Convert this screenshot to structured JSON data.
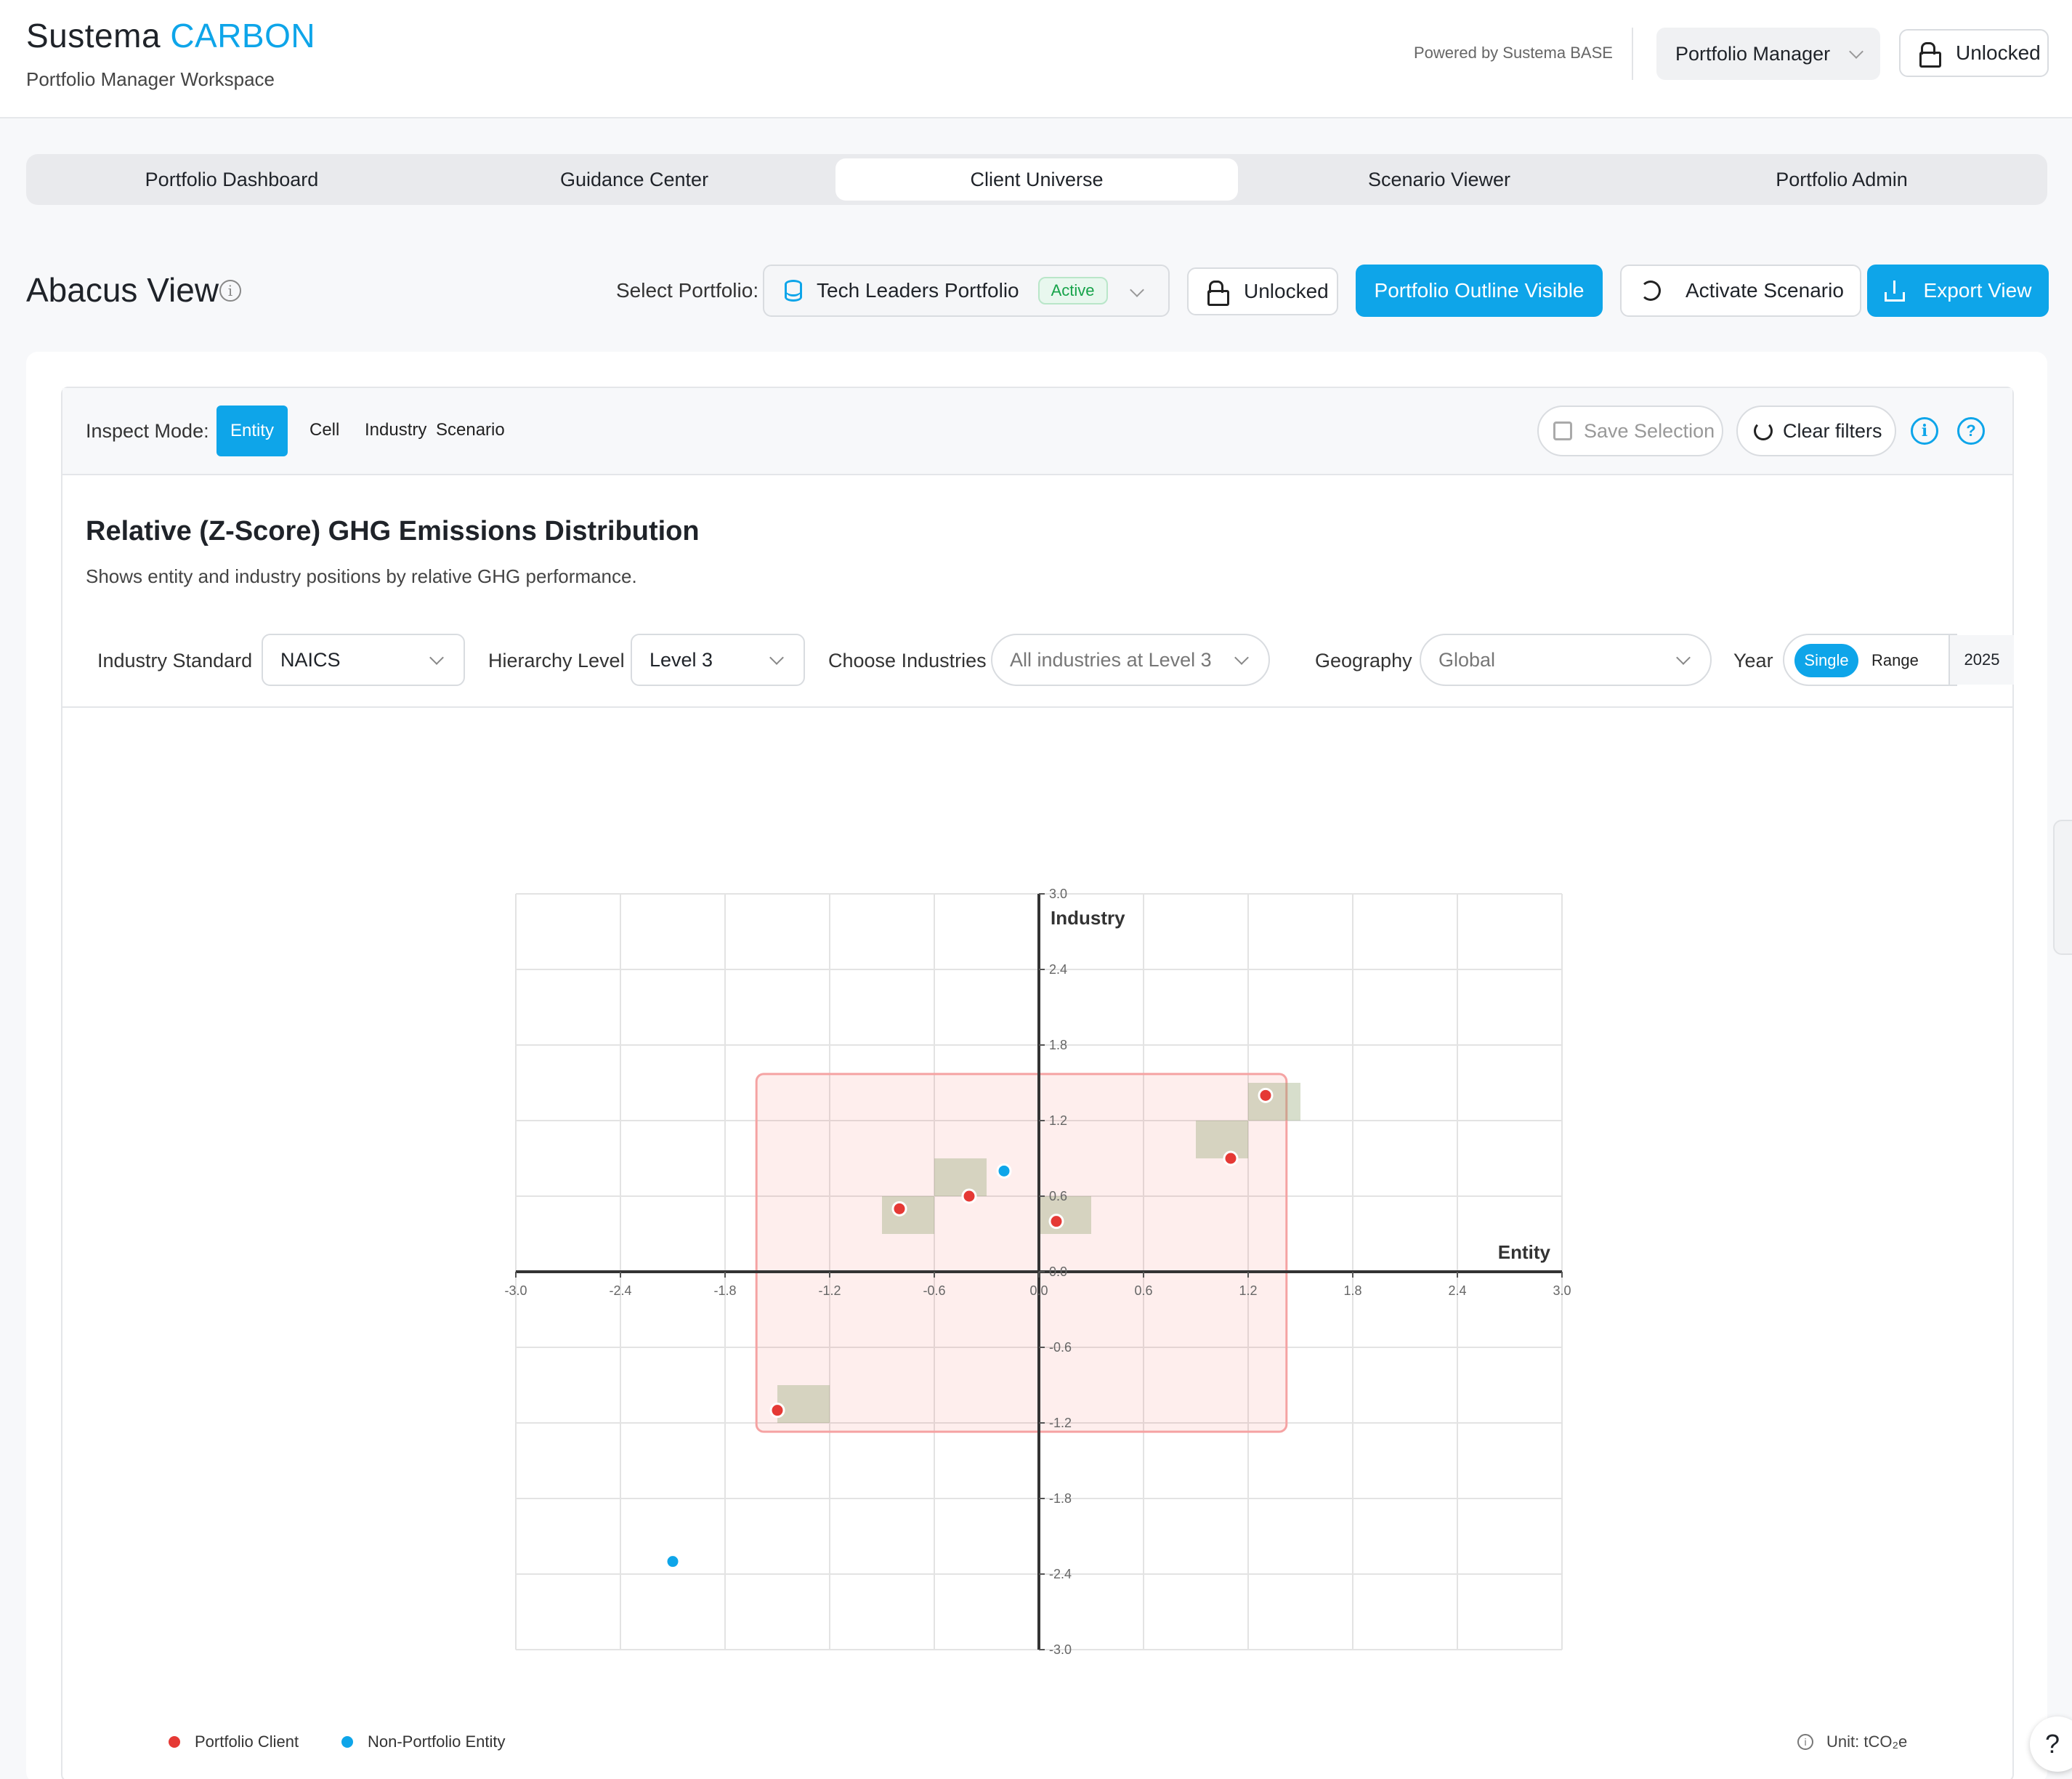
{
  "header": {
    "brand_main": "Sustema",
    "brand_accent": "CARBON",
    "workspace": "Portfolio Manager Workspace",
    "powered_by": "Powered by Sustema BASE",
    "role": "Portfolio Manager",
    "lock_status": "Unlocked"
  },
  "tabs": [
    "Portfolio Dashboard",
    "Guidance Center",
    "Client Universe",
    "Scenario Viewer",
    "Portfolio Admin"
  ],
  "active_tab": "Client Universe",
  "title_row": {
    "title": "Abacus View",
    "info_icon": "i",
    "select_portfolio_label": "Select Portfolio:",
    "portfolio": "Tech Leaders Portfolio",
    "portfolio_status": "Active",
    "lock_status": "Unlocked",
    "outline_button": "Portfolio Outline Visible",
    "activate_button": "Activate Scenario",
    "export_button": "Export View"
  },
  "inspect": {
    "label": "Inspect Mode:",
    "modes": [
      "Entity",
      "Cell",
      "Industry",
      "Scenario"
    ],
    "active_mode": "Entity",
    "save_selection": "Save Selection",
    "clear_filters": "Clear filters",
    "info_icon": "i",
    "help_icon": "?"
  },
  "chart_header": {
    "title": "Relative (Z-Score) GHG Emissions Distribution",
    "subtitle": "Shows entity and industry positions by relative GHG performance."
  },
  "filters": {
    "industry_standard_label": "Industry Standard",
    "industry_standard": "NAICS",
    "hierarchy_label": "Hierarchy Level",
    "hierarchy": "Level 3",
    "industries_label": "Choose Industries",
    "industries_placeholder": "All industries at Level 3",
    "geography_label": "Geography",
    "geography": "Global",
    "year_label": "Year",
    "year_single": "Single",
    "year_range": "Range",
    "year_value": "2025"
  },
  "chart_data": {
    "type": "scatter",
    "xlabel": "Entity",
    "ylabel": "Industry",
    "xlim": [
      -3.0,
      3.0
    ],
    "ylim": [
      -3.0,
      3.0
    ],
    "ticks": [
      "-3.0",
      "-2.4",
      "-1.8",
      "-1.2",
      "-0.6",
      "0.0",
      "0.6",
      "1.2",
      "1.8",
      "2.4",
      "3.0"
    ],
    "grid": true,
    "portfolio_outline": {
      "x": [
        -1.62,
        1.42
      ],
      "y": [
        -1.27,
        1.57
      ]
    },
    "cells": [
      {
        "x": [
          -1.5,
          -1.2
        ],
        "y": [
          -1.2,
          -0.9
        ]
      },
      {
        "x": [
          -0.9,
          -0.6
        ],
        "y": [
          0.3,
          0.6
        ]
      },
      {
        "x": [
          -0.6,
          -0.3
        ],
        "y": [
          0.6,
          0.9
        ]
      },
      {
        "x": [
          0.0,
          0.3
        ],
        "y": [
          0.3,
          0.6
        ]
      },
      {
        "x": [
          0.9,
          1.2
        ],
        "y": [
          0.9,
          1.2
        ]
      },
      {
        "x": [
          1.2,
          1.5
        ],
        "y": [
          1.2,
          1.5
        ]
      }
    ],
    "series": [
      {
        "name": "Portfolio Client",
        "color": "#e53935",
        "points": [
          [
            -1.5,
            -1.1
          ],
          [
            -0.8,
            0.5
          ],
          [
            -0.4,
            0.6
          ],
          [
            0.1,
            0.4
          ],
          [
            1.1,
            0.9
          ],
          [
            1.3,
            1.4
          ]
        ]
      },
      {
        "name": "Non-Portfolio Entity",
        "color": "#0ea5e9",
        "points": [
          [
            -0.2,
            0.8
          ],
          [
            -2.1,
            -2.3
          ]
        ]
      }
    ],
    "legend_position": "bottom-left"
  },
  "unit": {
    "label": "Unit:",
    "value": "tCO₂e"
  },
  "help_fab": "?"
}
